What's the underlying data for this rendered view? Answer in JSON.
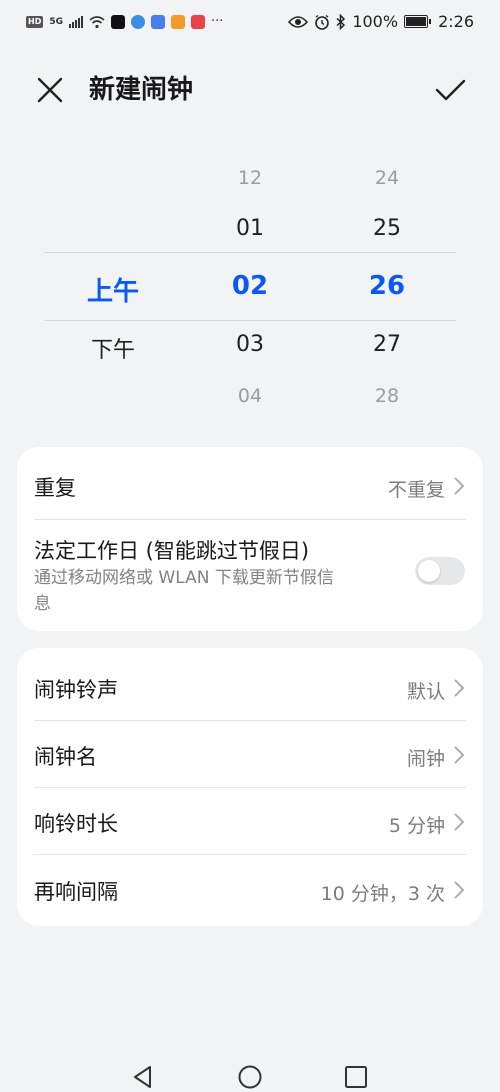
{
  "status_bar": {
    "left_badge": "HD",
    "network": "5G",
    "more": "···",
    "battery": "100%",
    "time": "2:26",
    "icons": [
      "hd-badge",
      "signal-icon",
      "wifi-icon",
      "tiktok-icon",
      "browser-icon",
      "app-icon",
      "video-app-icon",
      "reader-app-icon",
      "more-icon",
      "eye-icon",
      "alarm-icon",
      "bluetooth-icon",
      "battery-icon"
    ]
  },
  "header": {
    "title": "新建闹钟",
    "close_icon": "close-icon",
    "confirm_icon": "check-icon"
  },
  "picker": {
    "ampm": {
      "selected": "上午",
      "next": "下午"
    },
    "hours": {
      "far_prev": "12",
      "prev": "01",
      "selected": "02",
      "next": "03",
      "far_next": "04"
    },
    "minutes": {
      "far_prev": "24",
      "prev": "25",
      "selected": "26",
      "next": "27",
      "far_next": "28"
    }
  },
  "card1": {
    "repeat": {
      "label": "重复",
      "value": "不重复"
    },
    "workday": {
      "label": "法定工作日 (智能跳过节假日)",
      "sub_line1": "通过移动网络或 WLAN 下载更新节假信",
      "sub_line2": "息",
      "enabled": false
    }
  },
  "card2": {
    "rows": [
      {
        "label": "闹钟铃声",
        "value": "默认"
      },
      {
        "label": "闹钟名",
        "value": "闹钟"
      },
      {
        "label": "响铃时长",
        "value": "5 分钟"
      },
      {
        "label": "再响间隔",
        "value": "10 分钟，3 次"
      }
    ]
  },
  "colors": {
    "accent": "#0a59f7",
    "background": "#f1f3f5",
    "card": "#ffffff"
  },
  "navbar": {
    "icons": [
      "back-icon",
      "home-icon",
      "recents-icon"
    ]
  }
}
